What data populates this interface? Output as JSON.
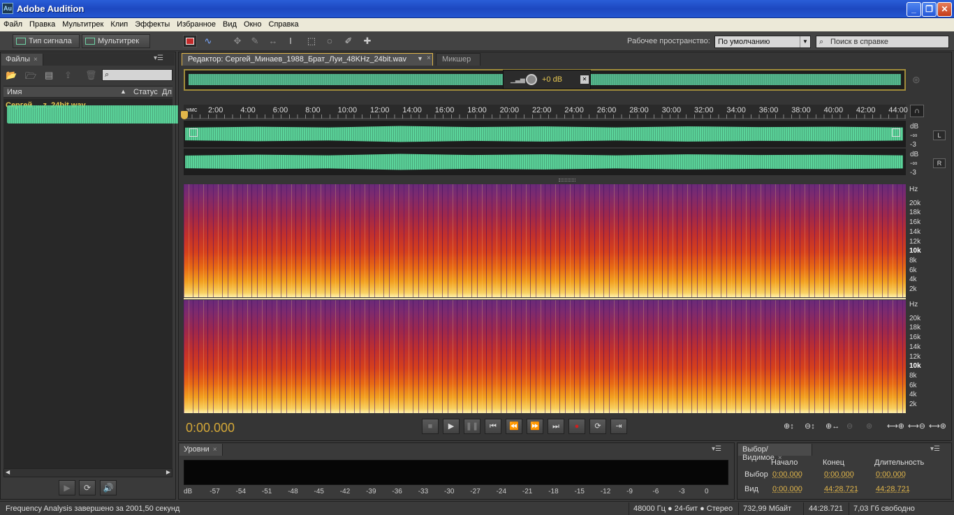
{
  "window": {
    "title": "Adobe Audition",
    "app_icon": "Au"
  },
  "menu": [
    "Файл",
    "Правка",
    "Мультитрек",
    "Клип",
    "Эффекты",
    "Избранное",
    "Вид",
    "Окно",
    "Справка"
  ],
  "toolbar": {
    "waveform_label": "Тип сигнала",
    "multitrack_label": "Мультитрек",
    "workspace_label": "Рабочее пространство:",
    "workspace_value": "По умолчанию",
    "help_search_placeholder": "Поиск в справке"
  },
  "files_panel": {
    "tab": "Файлы",
    "columns": [
      "Имя",
      "Статус",
      "Дл"
    ],
    "items": [
      {
        "name": "Сергей_...z_24bit.wav"
      }
    ]
  },
  "editor": {
    "tab": "Редактор: Сергей_Минаев_1988_Брат_Луи_48KHz_24bit.wav",
    "mixer_tab": "Микшер",
    "gain_readout": "+0 dB",
    "ruler": {
      "unit": "чмс",
      "labels": [
        "2:00",
        "4:00",
        "6:00",
        "8:00",
        "10:00",
        "12:00",
        "14:00",
        "16:00",
        "18:00",
        "20:00",
        "22:00",
        "24:00",
        "26:00",
        "28:00",
        "30:00",
        "32:00",
        "34:00",
        "36:00",
        "38:00",
        "40:00",
        "42:00",
        "44:00"
      ]
    },
    "channels": [
      {
        "label": "L",
        "db": [
          "dB",
          "-∞",
          "-3"
        ]
      },
      {
        "label": "R",
        "db": [
          "dB",
          "-∞",
          "-3"
        ]
      }
    ],
    "hz_scale": [
      "Hz",
      "20k",
      "18k",
      "16k",
      "14k",
      "12k",
      "10k",
      "8k",
      "6k",
      "4k",
      "2k"
    ],
    "timecode": "0:00.000"
  },
  "levels_panel": {
    "tab": "Уровни",
    "scale": [
      "dB",
      "-57",
      "-54",
      "-51",
      "-48",
      "-45",
      "-42",
      "-39",
      "-36",
      "-33",
      "-30",
      "-27",
      "-24",
      "-21",
      "-18",
      "-15",
      "-12",
      "-9",
      "-6",
      "-3",
      "0"
    ]
  },
  "selection_panel": {
    "tab": "Выбор/Видимое",
    "headers": [
      "Начало",
      "Конец",
      "Длительность"
    ],
    "rows": [
      {
        "label": "Выбор",
        "start": "0:00.000",
        "end": "0:00.000",
        "duration": "0:00.000"
      },
      {
        "label": "Вид",
        "start": "0:00.000",
        "end": "44:28.721",
        "duration": "44:28.721"
      }
    ]
  },
  "status": {
    "message": "Frequency Analysis завершено за 2001,50 секунд",
    "format": "48000 Гц ● 24-бит ● Стерео",
    "size": "732,99 Мбайт",
    "duration": "44:28.721",
    "free": "7,03 Гб свободно"
  },
  "colors": {
    "waveform": "#5ad49a",
    "accent": "#e2b64a"
  }
}
